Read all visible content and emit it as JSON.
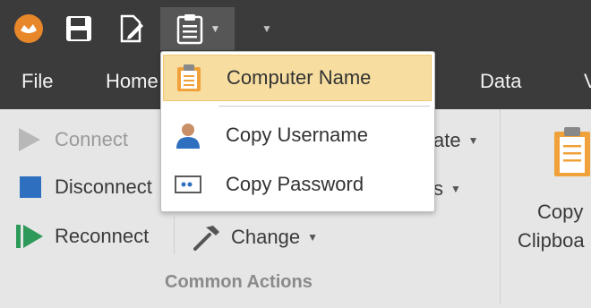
{
  "menu": {
    "file": "File",
    "home": "Home",
    "data": "Data",
    "partial": "V"
  },
  "qat": {
    "icons": [
      "app-logo-icon",
      "save-icon",
      "edit-document-icon",
      "clipboard-icon",
      "customize-dropdown-icon"
    ]
  },
  "ribbon": {
    "connect": "Connect",
    "disconnect": "Disconnect",
    "reconnect": "Reconnect",
    "change": "Change",
    "partial_update": "ate",
    "partial_s": "s",
    "group_label": "Common Actions",
    "copy_line1": "Copy",
    "copy_line2": "Clipboa"
  },
  "dropdown": {
    "items": [
      {
        "label": "Computer Name",
        "icon": "clipboard-icon",
        "highlighted": true
      },
      {
        "label": "Copy  Username",
        "icon": "user-icon",
        "highlighted": false
      },
      {
        "label": "Copy  Password",
        "icon": "password-icon",
        "highlighted": false
      }
    ]
  },
  "colors": {
    "titlebar": "#3b3b3b",
    "ribbon": "#e6e6e6",
    "highlight": "#f7dea0",
    "accent_blue": "#2f6fc0",
    "accent_green": "#2e9a5a",
    "logo_orange": "#e8872a"
  }
}
